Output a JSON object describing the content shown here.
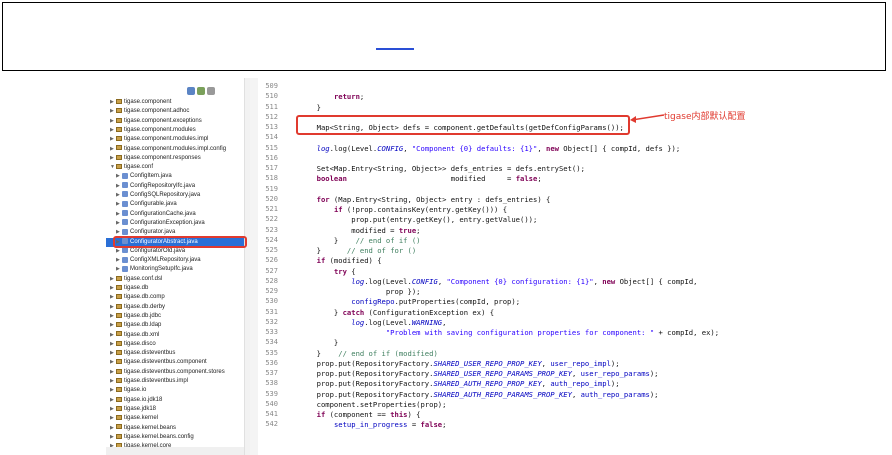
{
  "annotation": "tigase内部默认配置",
  "colors": {
    "highlight": "#e03a2f",
    "selection": "#2a6fd6"
  },
  "tree": [
    {
      "label": "tigase.component",
      "type": "pkg",
      "indent": 0
    },
    {
      "label": "tigase.component.adhoc",
      "type": "pkg",
      "indent": 0
    },
    {
      "label": "tigase.component.exceptions",
      "type": "pkg",
      "indent": 0
    },
    {
      "label": "tigase.component.modules",
      "type": "pkg",
      "indent": 0
    },
    {
      "label": "tigase.component.modules.impl",
      "type": "pkg",
      "indent": 0
    },
    {
      "label": "tigase.component.modules.impl.config",
      "type": "pkg",
      "indent": 0
    },
    {
      "label": "tigase.component.responses",
      "type": "pkg",
      "indent": 0
    },
    {
      "label": "tigase.conf",
      "type": "pkg",
      "indent": 0,
      "open": true
    },
    {
      "label": "ConfigItem.java",
      "type": "java",
      "indent": 1
    },
    {
      "label": "ConfigRepositoryIfc.java",
      "type": "java",
      "indent": 1
    },
    {
      "label": "ConfigSQLRepository.java",
      "type": "java",
      "indent": 1
    },
    {
      "label": "Configurable.java",
      "type": "java",
      "indent": 1
    },
    {
      "label": "ConfigurationCache.java",
      "type": "java",
      "indent": 1
    },
    {
      "label": "ConfigurationException.java",
      "type": "java",
      "indent": 1
    },
    {
      "label": "Configurator.java",
      "type": "java",
      "indent": 1
    },
    {
      "label": "ConfiguratorAbstract.java",
      "type": "java",
      "indent": 1,
      "selected": true
    },
    {
      "label": "ConfiguratorOld.java",
      "type": "java",
      "indent": 1
    },
    {
      "label": "ConfigXMLRepository.java",
      "type": "java",
      "indent": 1
    },
    {
      "label": "MonitoringSetupIfc.java",
      "type": "java",
      "indent": 1
    },
    {
      "label": "tigase.conf.dsl",
      "type": "pkg",
      "indent": 0
    },
    {
      "label": "tigase.db",
      "type": "pkg",
      "indent": 0
    },
    {
      "label": "tigase.db.comp",
      "type": "pkg",
      "indent": 0
    },
    {
      "label": "tigase.db.derby",
      "type": "pkg",
      "indent": 0
    },
    {
      "label": "tigase.db.jdbc",
      "type": "pkg",
      "indent": 0
    },
    {
      "label": "tigase.db.ldap",
      "type": "pkg",
      "indent": 0
    },
    {
      "label": "tigase.db.xml",
      "type": "pkg",
      "indent": 0
    },
    {
      "label": "tigase.disco",
      "type": "pkg",
      "indent": 0
    },
    {
      "label": "tigase.disteventbus",
      "type": "pkg",
      "indent": 0
    },
    {
      "label": "tigase.disteventbus.component",
      "type": "pkg",
      "indent": 0
    },
    {
      "label": "tigase.disteventbus.component.stores",
      "type": "pkg",
      "indent": 0
    },
    {
      "label": "tigase.disteventbus.impl",
      "type": "pkg",
      "indent": 0
    },
    {
      "label": "tigase.io",
      "type": "pkg",
      "indent": 0
    },
    {
      "label": "tigase.io.jdk18",
      "type": "pkg",
      "indent": 0
    },
    {
      "label": "tigase.jdk18",
      "type": "pkg",
      "indent": 0
    },
    {
      "label": "tigase.kernel",
      "type": "pkg",
      "indent": 0
    },
    {
      "label": "tigase.kernel.beans",
      "type": "pkg",
      "indent": 0
    },
    {
      "label": "tigase.kernel.beans.config",
      "type": "pkg",
      "indent": 0
    },
    {
      "label": "tigase.kernel.core",
      "type": "pkg",
      "indent": 0
    }
  ],
  "code": [
    {
      "n": "509",
      "html": ""
    },
    {
      "n": "510",
      "html": "            <span class='kw'>return</span>;"
    },
    {
      "n": "511",
      "html": "        }"
    },
    {
      "n": "512",
      "html": ""
    },
    {
      "n": "513",
      "html": "        Map&lt;String, Object&gt; defs = component.getDefaults(getDefConfigParams());"
    },
    {
      "n": "514",
      "html": ""
    },
    {
      "n": "515",
      "html": "        <span class='it'>log</span>.log(Level.<span class='it'>CONFIG</span>, <span class='st'>\"Component {0} defaults: {1}\"</span>, <span class='kw'>new</span> Object[] { compId, defs });"
    },
    {
      "n": "516",
      "html": ""
    },
    {
      "n": "517",
      "html": "        Set&lt;Map.Entry&lt;String, Object&gt;&gt; defs_entries = defs.entrySet();"
    },
    {
      "n": "518",
      "html": "        <span class='kw'>boolean</span>                        modified     = <span class='kw'>false</span>;"
    },
    {
      "n": "519",
      "html": ""
    },
    {
      "n": "520",
      "html": "        <span class='kw'>for</span> (Map.Entry&lt;String, Object&gt; entry : defs_entries) {"
    },
    {
      "n": "521",
      "html": "            <span class='kw'>if</span> (!prop.containsKey(entry.getKey())) {"
    },
    {
      "n": "522",
      "html": "                prop.put(entry.getKey(), entry.getValue());"
    },
    {
      "n": "523",
      "html": "                modified = <span class='kw'>true</span>;"
    },
    {
      "n": "524",
      "html": "            }    <span class='cm'>// end of if ()</span>"
    },
    {
      "n": "525",
      "html": "        }      <span class='cm'>// end of for ()</span>"
    },
    {
      "n": "526",
      "html": "        <span class='kw'>if</span> (modified) {"
    },
    {
      "n": "527",
      "html": "            <span class='kw'>try</span> {"
    },
    {
      "n": "528",
      "html": "                <span class='it'>log</span>.log(Level.<span class='it'>CONFIG</span>, <span class='st'>\"Component {0} configuration: {1}\"</span>, <span class='kw'>new</span> Object[] { compId,"
    },
    {
      "n": "529",
      "html": "                        prop });"
    },
    {
      "n": "530",
      "html": "                <span class='fld'>configRepo</span>.putProperties(compId, prop);"
    },
    {
      "n": "531",
      "html": "            } <span class='kw'>catch</span> (ConfigurationException ex) {"
    },
    {
      "n": "532",
      "html": "                <span class='it'>log</span>.log(Level.<span class='it'>WARNING</span>,"
    },
    {
      "n": "533",
      "html": "                        <span class='st'>\"Problem with saving configuration properties for component: \"</span> + compId, ex);"
    },
    {
      "n": "534",
      "html": "            }"
    },
    {
      "n": "535",
      "html": "        }    <span class='cm'>// end of if (modified)</span>"
    },
    {
      "n": "536",
      "html": "        prop.put(RepositoryFactory.<span class='it'>SHARED_USER_REPO_PROP_KEY</span>, <span class='fld'>user_repo_impl</span>);"
    },
    {
      "n": "537",
      "html": "        prop.put(RepositoryFactory.<span class='it'>SHARED_USER_REPO_PARAMS_PROP_KEY</span>, <span class='fld'>user_repo_params</span>);"
    },
    {
      "n": "538",
      "html": "        prop.put(RepositoryFactory.<span class='it'>SHARED_AUTH_REPO_PROP_KEY</span>, <span class='fld'>auth_repo_impl</span>);"
    },
    {
      "n": "539",
      "html": "        prop.put(RepositoryFactory.<span class='it'>SHARED_AUTH_REPO_PARAMS_PROP_KEY</span>, <span class='fld'>auth_repo_params</span>);"
    },
    {
      "n": "540",
      "html": "        component.setProperties(prop);"
    },
    {
      "n": "541",
      "html": "        <span class='kw'>if</span> (component == <span class='kw'>this</span>) {"
    },
    {
      "n": "542",
      "html": "            <span class='fld'>setup_in_progress</span> = <span class='kw'>false</span>;"
    }
  ]
}
